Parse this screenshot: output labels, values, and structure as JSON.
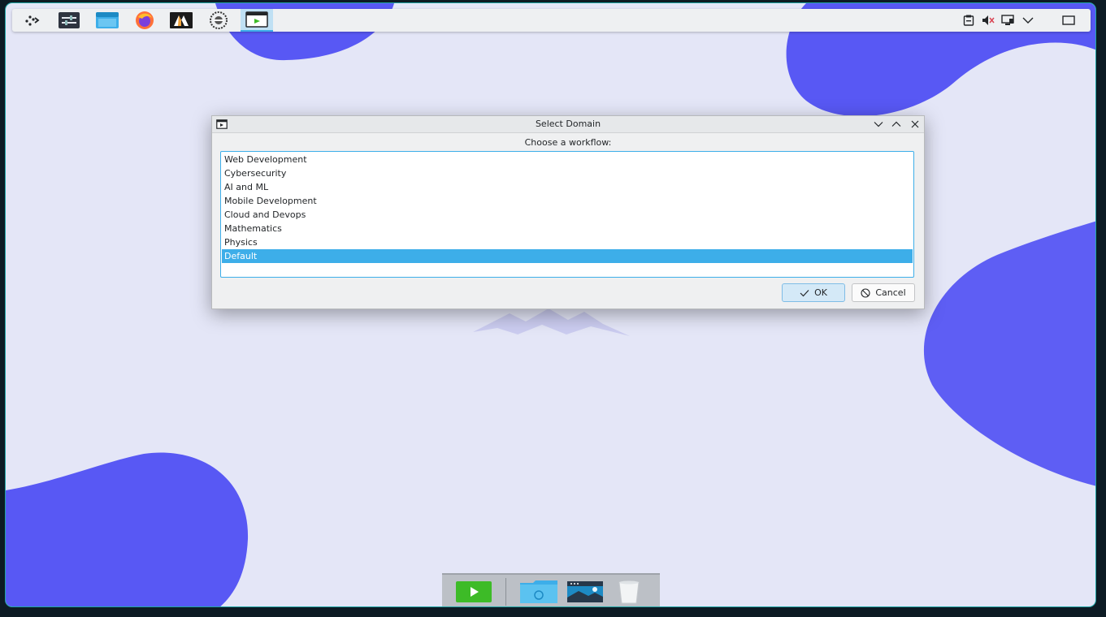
{
  "taskbar": {
    "launchers": [
      {
        "name": "app-launcher-icon"
      },
      {
        "name": "settings-icon"
      },
      {
        "name": "file-manager-icon"
      },
      {
        "name": "firefox-icon"
      },
      {
        "name": "terminal-icon"
      },
      {
        "name": "app-icon"
      },
      {
        "name": "media-window-icon"
      }
    ],
    "tray": [
      {
        "name": "clipboard-icon"
      },
      {
        "name": "volume-muted-icon"
      },
      {
        "name": "network-icon"
      },
      {
        "name": "chevron-down-icon"
      },
      {
        "name": "show-desktop-icon"
      }
    ]
  },
  "dialog": {
    "title": "Select Domain",
    "prompt": "Choose a workflow:",
    "items": [
      "Web Development",
      "Cybersecurity",
      "AI and ML",
      "Mobile Development",
      "Cloud and Devops",
      "Mathematics",
      "Physics",
      "Default"
    ],
    "selected_index": 7,
    "ok_label": "OK",
    "cancel_label": "Cancel"
  },
  "colors": {
    "accent": "#3daee9",
    "wallpaper_blob": "#5858f4",
    "wallpaper_bg": "#e4e6f7",
    "dock_play": "#3dbb27"
  },
  "dock": [
    {
      "name": "play-icon"
    },
    {
      "name": "folder-sync-icon"
    },
    {
      "name": "image-viewer-icon"
    },
    {
      "name": "trash-icon"
    }
  ]
}
